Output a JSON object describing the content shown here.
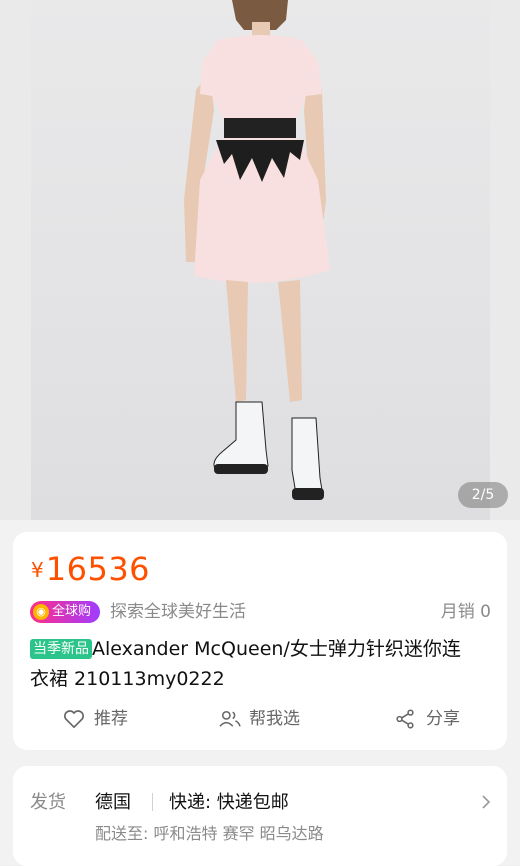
{
  "gallery": {
    "indicator": "2/5"
  },
  "product": {
    "currency": "¥",
    "price": "16536",
    "global_badge": "全球购",
    "slogan": "探索全球美好生活",
    "sales": "月销 0",
    "new_tag": "当季新品",
    "title_line1": "Alexander McQueen/女士弹力针织迷你连",
    "title_line2": "衣裙 210113my0222"
  },
  "actions": {
    "recommend": "推荐",
    "help_choose": "帮我选",
    "share": "分享"
  },
  "shipping": {
    "label": "发货",
    "origin": "德国",
    "method": "快递: 快递包邮",
    "destination": "配送至: 呼和浩特 赛罕 昭乌达路"
  },
  "colors": {
    "price": "#ff5000",
    "new_tag": "#2bc48a",
    "badge_start": "#ff2e88",
    "badge_end": "#a03cff"
  },
  "icons": {
    "recommend": "heart-outline-icon",
    "help_choose": "people-icon",
    "share": "share-icon",
    "shipping": "chevron-right-icon"
  }
}
